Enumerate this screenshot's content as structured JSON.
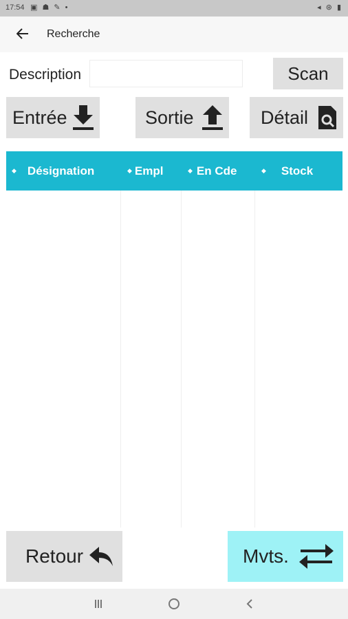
{
  "status_bar": {
    "time": "17:54",
    "left_icons": "▣ ☗ ✎ •",
    "right_icons": "◂ ⊛ ▮"
  },
  "app_bar": {
    "title": "Recherche",
    "back_icon": "arrow-left-icon"
  },
  "search": {
    "label": "Description",
    "value": "",
    "scan_label": "Scan"
  },
  "actions": {
    "entree": {
      "label": "Entrée",
      "icon": "download-icon"
    },
    "sortie": {
      "label": "Sortie",
      "icon": "upload-icon"
    },
    "detail": {
      "label": "Détail",
      "icon": "document-search-icon"
    }
  },
  "table": {
    "columns": [
      {
        "label": "Désignation"
      },
      {
        "label": "Empl"
      },
      {
        "label": "En Cde"
      },
      {
        "label": "Stock"
      }
    ],
    "rows": []
  },
  "footer": {
    "retour": {
      "label": "Retour",
      "icon": "reply-icon"
    },
    "mvts": {
      "label": "Mvts.",
      "icon": "swap-arrows-icon"
    }
  },
  "nav_bar": {
    "recent_icon": "recent-apps-icon",
    "home_icon": "home-icon",
    "back_icon": "back-chevron-icon"
  },
  "colors": {
    "header_bg": "#1bb8d0",
    "mvts_bg": "#9ef2f6",
    "button_bg": "#e0e0e0"
  }
}
